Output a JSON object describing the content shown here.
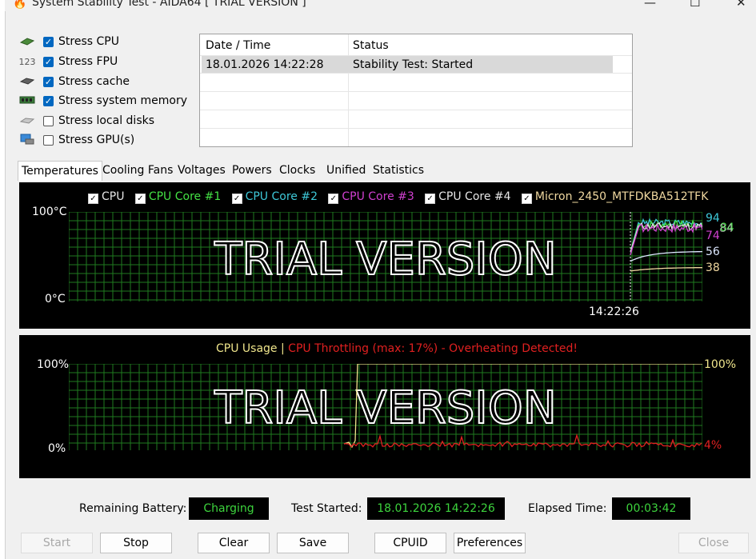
{
  "window": {
    "title": "System Stability Test - AIDA64  [ TRIAL VERSION ]",
    "minimize_glyph": "—",
    "maximize_glyph": "☐",
    "close_glyph": "✕"
  },
  "stress_options": [
    {
      "label": "Stress CPU",
      "checked": true,
      "icon": "cpu-chip-icon"
    },
    {
      "label": "Stress FPU",
      "checked": true,
      "icon": "fpu-123-icon"
    },
    {
      "label": "Stress cache",
      "checked": true,
      "icon": "cache-chip-icon"
    },
    {
      "label": "Stress system memory",
      "checked": true,
      "icon": "memory-module-icon"
    },
    {
      "label": "Stress local disks",
      "checked": false,
      "icon": "disk-drive-icon"
    },
    {
      "label": "Stress GPU(s)",
      "checked": false,
      "icon": "gpu-card-icon"
    }
  ],
  "fpu_icon_text": "123",
  "log": {
    "headers": [
      "Date / Time",
      "Status"
    ],
    "rows": [
      {
        "datetime": "18.01.2026 14:22:28",
        "status": "Stability Test: Started"
      }
    ]
  },
  "tabs": [
    "Temperatures",
    "Cooling Fans",
    "Voltages",
    "Powers",
    "Clocks",
    "Unified",
    "Statistics"
  ],
  "active_tab": "Temperatures",
  "watermark": "TRIAL VERSION",
  "check_glyph": "✓",
  "temp_graph": {
    "legend": [
      {
        "label": "CPU",
        "color": "#e6e6e6"
      },
      {
        "label": "CPU Core #1",
        "color": "#44e044"
      },
      {
        "label": "CPU Core #2",
        "color": "#3ec8d8"
      },
      {
        "label": "CPU Core #3",
        "color": "#d040d0"
      },
      {
        "label": "CPU Core #4",
        "color": "#e6e6e6"
      },
      {
        "label": "Micron_2450_MTFDKBA512TFK",
        "color": "#f0d8a0"
      }
    ],
    "y_max_label": "100°C",
    "y_min_label": "0°C",
    "time_label": "14:22:26",
    "readouts": [
      {
        "value": "94",
        "color": "#3ec8d8"
      },
      {
        "value": "84",
        "color": "#44e044"
      },
      {
        "value": "84",
        "color": "#e6e6e6"
      },
      {
        "value": "74",
        "color": "#d040d0"
      },
      {
        "value": "56",
        "color": "#dde8ff"
      },
      {
        "value": "38",
        "color": "#f0d8a0"
      }
    ]
  },
  "usage_graph": {
    "title_usage": "CPU Usage",
    "separator": "|",
    "title_throttle": "CPU Throttling (max: 17%) - Overheating Detected!",
    "usage_color": "#f0e68c",
    "throttle_color": "#e02020",
    "y_max_label": "100%",
    "y_min_label": "0%",
    "readout_usage": "100%",
    "readout_throttle": "4%"
  },
  "status_bar": {
    "battery_label": "Remaining Battery:",
    "battery_value": "Charging",
    "test_started_label": "Test Started:",
    "test_started_value": "18.01.2026 14:22:26",
    "elapsed_label": "Elapsed Time:",
    "elapsed_value": "00:03:42"
  },
  "buttons": {
    "start": "Start",
    "stop": "Stop",
    "clear": "Clear",
    "save": "Save",
    "cpuid": "CPUID",
    "preferences": "Preferences",
    "close": "Close"
  },
  "colors": {
    "grid": "#1f7a1f",
    "accent": "#0067c0"
  }
}
